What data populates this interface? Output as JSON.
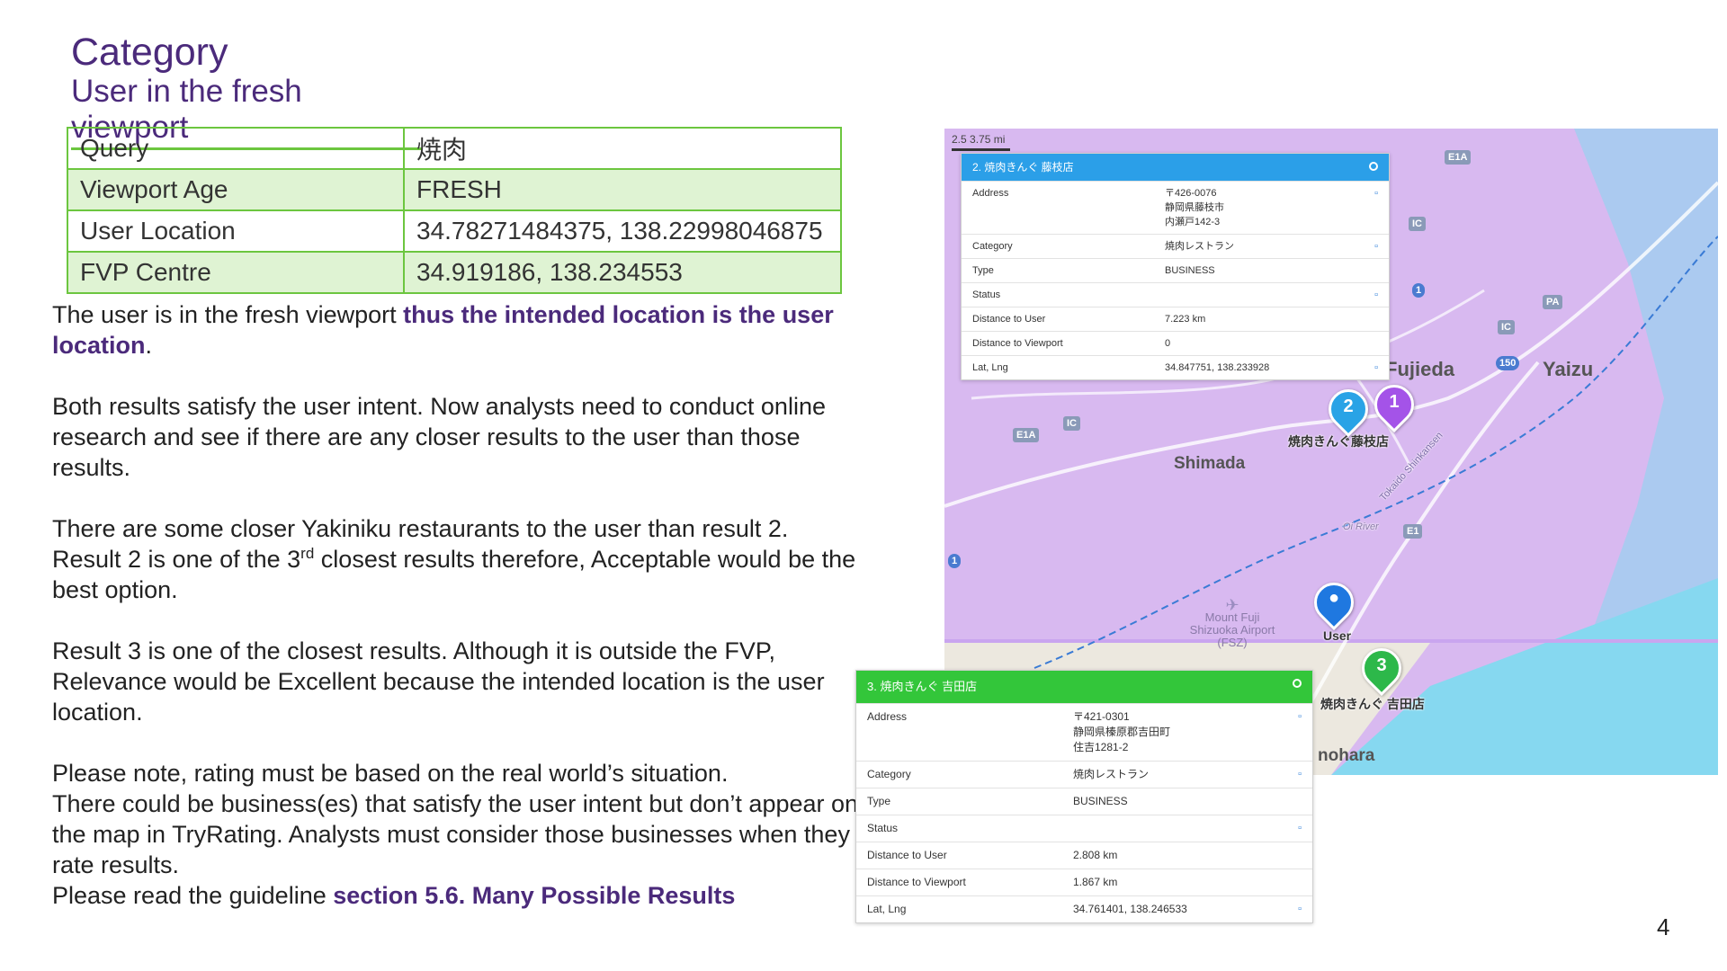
{
  "title": "Category",
  "subtitle": "User in the fresh viewport",
  "info_table": [
    {
      "key": "Query",
      "value": "焼肉"
    },
    {
      "key": "Viewport Age",
      "value": "FRESH"
    },
    {
      "key": "User Location",
      "value": "34.78271484375, 138.22998046875"
    },
    {
      "key": "FVP Centre",
      "value": "34.919186, 138.234553"
    }
  ],
  "paragraphs": {
    "p1_a": "The user is in the fresh viewport ",
    "p1_b": "thus the intended location is the user location",
    "p1_c": ".",
    "p2": "Both results satisfy the user intent. Now analysts need to conduct online research and see if there are any closer results to the user than those results.",
    "p3_a": "There are some closer Yakiniku restaurants to the user than result 2. Result 2 is one of the 3",
    "p3_sup": "rd",
    "p3_b": " closest results therefore, Acceptable would be the best option.",
    "p4": "Result 3 is one of the closest results. Although it is outside the FVP, Relevance would be Excellent because the intended location is the user location.",
    "p5_line1": "Please note, rating must be based on the real world’s situation.",
    "p5_line2": "There could be business(es) that satisfy the user intent but don’t appear on the map in TryRating. Analysts must consider those businesses when they rate results.",
    "p5_line3_a": "Please read the guideline ",
    "p5_line3_b": "section 5.6. Many Possible Results"
  },
  "page_number": "4",
  "map": {
    "scale_text": "2.5      3.75 mi",
    "cities": {
      "fujieda": "Fujieda",
      "yaizu": "Yaizu",
      "shimada": "Shimada",
      "makinohara": "nohara",
      "river": "Oi River"
    },
    "airport": "Mount Fuji Shizuoka Airport (FSZ)",
    "road_label": "Tokaido Shinkansen",
    "shields": {
      "e1a_1": "E1A",
      "e1a_2": "E1A",
      "ic1": "IC",
      "ic2": "IC",
      "ic3": "IC",
      "pa": "PA",
      "e1": "E1",
      "r150": "150",
      "r1": "1"
    },
    "pins": {
      "p1": {
        "num": "1",
        "color": "#a453e8"
      },
      "p2": {
        "num": "2",
        "color": "#29a3e6",
        "label": "焼肉きんぐ藤枝店"
      },
      "p3": {
        "num": "3",
        "color": "#2db84a",
        "label": "焼肉きんぐ 吉田店"
      },
      "user": {
        "label": "User",
        "color": "#1f78e0"
      }
    },
    "colors": {
      "viewport": "#d8b9f0",
      "sea": "#86d8f0",
      "land": "#ece8df"
    }
  },
  "card2": {
    "header": "2. 焼肉きんぐ 藤枝店",
    "header_color": "#2b9fe8",
    "rows": [
      {
        "k": "Address",
        "v1": "〒426-0076",
        "v2": "静岡県藤枝市",
        "v3": "内瀬戸142-3",
        "icon": true
      },
      {
        "k": "Category",
        "v1": "焼肉レストラン",
        "icon": true
      },
      {
        "k": "Type",
        "v1": "BUSINESS",
        "icon": false
      },
      {
        "k": "Status",
        "v1": "",
        "icon": true
      },
      {
        "k": "Distance to User",
        "v1": "7.223 km",
        "icon": false
      },
      {
        "k": "Distance to Viewport",
        "v1": "0",
        "icon": false
      },
      {
        "k": "Lat, Lng",
        "v1": "34.847751, 138.233928",
        "icon": true
      }
    ]
  },
  "card3": {
    "header": "3. 焼肉きんぐ 吉田店",
    "header_color": "#33c63a",
    "rows": [
      {
        "k": "Address",
        "v1": "〒421-0301",
        "v2": "静岡県榛原郡吉田町",
        "v3": "住吉1281-2",
        "icon": true
      },
      {
        "k": "Category",
        "v1": "焼肉レストラン",
        "icon": true
      },
      {
        "k": "Type",
        "v1": "BUSINESS",
        "icon": false
      },
      {
        "k": "Status",
        "v1": "",
        "icon": true
      },
      {
        "k": "Distance to User",
        "v1": "2.808 km",
        "icon": false
      },
      {
        "k": "Distance to Viewport",
        "v1": "1.867 km",
        "icon": false
      },
      {
        "k": "Lat, Lng",
        "v1": "34.761401, 138.246533",
        "icon": true
      }
    ]
  }
}
